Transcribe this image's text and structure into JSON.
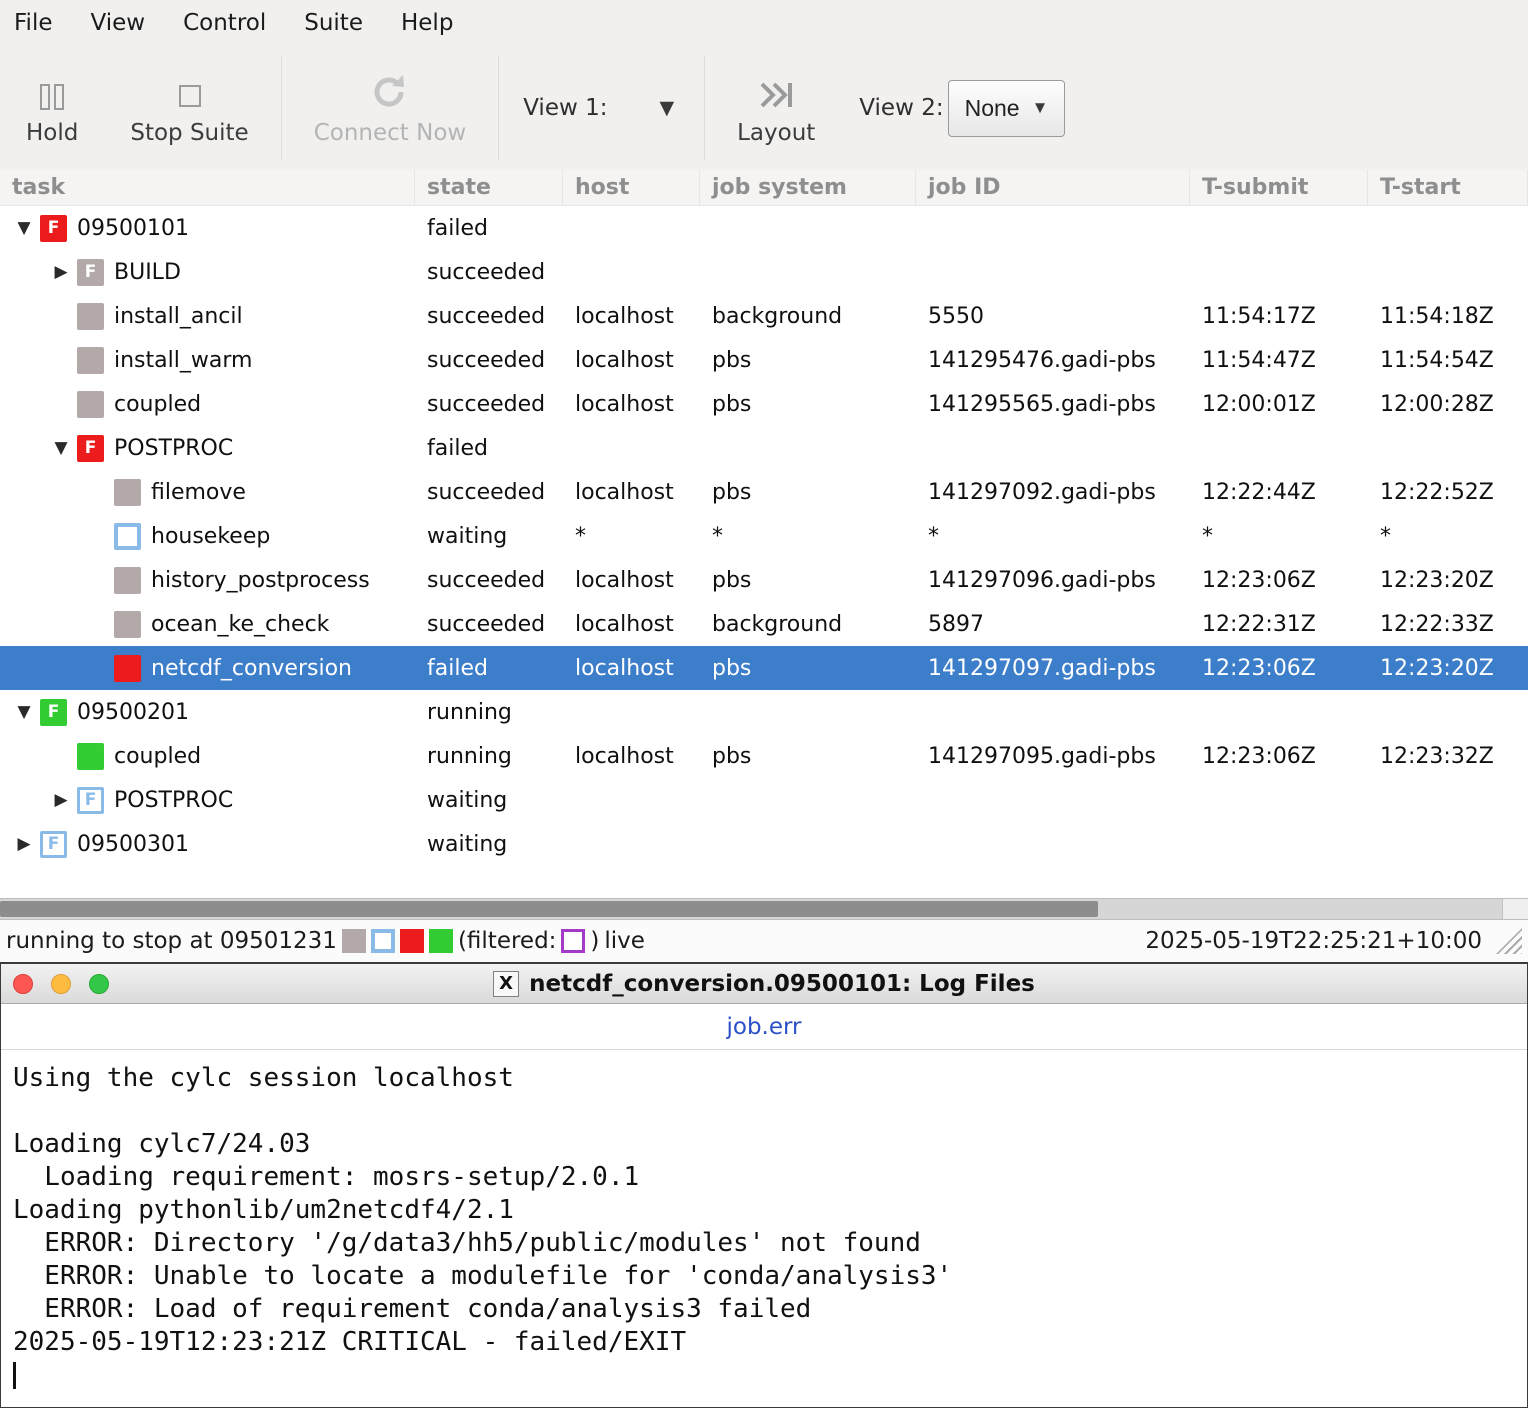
{
  "menu": {
    "items": [
      "File",
      "View",
      "Control",
      "Suite",
      "Help"
    ]
  },
  "toolbar": {
    "hold_label": "Hold",
    "stop_suite_label": "Stop Suite",
    "connect_now_label": "Connect Now",
    "view1_label": "View 1:",
    "layout_label": "Layout",
    "view2_label": "View 2:",
    "view2_value": "None"
  },
  "table": {
    "columns": [
      "task",
      "state",
      "host",
      "job system",
      "job ID",
      "T-submit",
      "T-start"
    ],
    "rows": [
      {
        "level": 0,
        "expander": "open",
        "icon": "family-failed",
        "task": "09500101",
        "state": "failed",
        "host": "",
        "job_system": "",
        "job_id": "",
        "t_submit": "",
        "t_start": "",
        "selected": false
      },
      {
        "level": 1,
        "expander": "closed",
        "icon": "family-succeeded",
        "task": "BUILD",
        "state": "succeeded",
        "host": "",
        "job_system": "",
        "job_id": "",
        "t_submit": "",
        "t_start": "",
        "selected": false
      },
      {
        "level": 1,
        "expander": null,
        "icon": "task-succeeded",
        "task": "install_ancil",
        "state": "succeeded",
        "host": "localhost",
        "job_system": "background",
        "job_id": "5550",
        "t_submit": "11:54:17Z",
        "t_start": "11:54:18Z",
        "selected": false
      },
      {
        "level": 1,
        "expander": null,
        "icon": "task-succeeded",
        "task": "install_warm",
        "state": "succeeded",
        "host": "localhost",
        "job_system": "pbs",
        "job_id": "141295476.gadi-pbs",
        "t_submit": "11:54:47Z",
        "t_start": "11:54:54Z",
        "selected": false
      },
      {
        "level": 1,
        "expander": null,
        "icon": "task-succeeded",
        "task": "coupled",
        "state": "succeeded",
        "host": "localhost",
        "job_system": "pbs",
        "job_id": "141295565.gadi-pbs",
        "t_submit": "12:00:01Z",
        "t_start": "12:00:28Z",
        "selected": false
      },
      {
        "level": 1,
        "expander": "open",
        "icon": "family-failed",
        "task": "POSTPROC",
        "state": "failed",
        "host": "",
        "job_system": "",
        "job_id": "",
        "t_submit": "",
        "t_start": "",
        "selected": false
      },
      {
        "level": 2,
        "expander": null,
        "icon": "task-succeeded",
        "task": "filemove",
        "state": "succeeded",
        "host": "localhost",
        "job_system": "pbs",
        "job_id": "141297092.gadi-pbs",
        "t_submit": "12:22:44Z",
        "t_start": "12:22:52Z",
        "selected": false
      },
      {
        "level": 2,
        "expander": null,
        "icon": "task-waiting",
        "task": "housekeep",
        "state": "waiting",
        "host": "*",
        "job_system": "*",
        "job_id": "*",
        "t_submit": "*",
        "t_start": "*",
        "selected": false
      },
      {
        "level": 2,
        "expander": null,
        "icon": "task-succeeded",
        "task": "history_postprocess",
        "state": "succeeded",
        "host": "localhost",
        "job_system": "pbs",
        "job_id": "141297096.gadi-pbs",
        "t_submit": "12:23:06Z",
        "t_start": "12:23:20Z",
        "selected": false
      },
      {
        "level": 2,
        "expander": null,
        "icon": "task-succeeded",
        "task": "ocean_ke_check",
        "state": "succeeded",
        "host": "localhost",
        "job_system": "background",
        "job_id": "5897",
        "t_submit": "12:22:31Z",
        "t_start": "12:22:33Z",
        "selected": false
      },
      {
        "level": 2,
        "expander": null,
        "icon": "task-failed",
        "task": "netcdf_conversion",
        "state": "failed",
        "host": "localhost",
        "job_system": "pbs",
        "job_id": "141297097.gadi-pbs",
        "t_submit": "12:23:06Z",
        "t_start": "12:23:20Z",
        "selected": true
      },
      {
        "level": 0,
        "expander": "open",
        "icon": "family-running",
        "task": "09500201",
        "state": "running",
        "host": "",
        "job_system": "",
        "job_id": "",
        "t_submit": "",
        "t_start": "",
        "selected": false
      },
      {
        "level": 1,
        "expander": null,
        "icon": "task-running",
        "task": "coupled",
        "state": "running",
        "host": "localhost",
        "job_system": "pbs",
        "job_id": "141297095.gadi-pbs",
        "t_submit": "12:23:06Z",
        "t_start": "12:23:32Z",
        "selected": false
      },
      {
        "level": 1,
        "expander": "closed",
        "icon": "family-waiting",
        "task": "POSTPROC",
        "state": "waiting",
        "host": "",
        "job_system": "",
        "job_id": "",
        "t_submit": "",
        "t_start": "",
        "selected": false
      },
      {
        "level": 0,
        "expander": "closed",
        "icon": "family-waiting",
        "task": "09500301",
        "state": "waiting",
        "host": "",
        "job_system": "",
        "job_id": "",
        "t_submit": "",
        "t_start": "",
        "selected": false
      }
    ]
  },
  "statusbar": {
    "left_text": "running to stop at 09501231",
    "filtered_open": "(filtered:",
    "filtered_close": ")",
    "live_label": "live",
    "timestamp": "2025-05-19T22:25:21+10:00"
  },
  "log_window": {
    "title": "netcdf_conversion.09500101: Log Files",
    "window_icon": "X",
    "tab": "job.err",
    "log_text": "Using the cylc session localhost\n\nLoading cylc7/24.03\n  Loading requirement: mosrs-setup/2.0.1\nLoading pythonlib/um2netcdf4/2.1\n  ERROR: Directory '/g/data3/hh5/public/modules' not found\n  ERROR: Unable to locate a modulefile for 'conda/analysis3'\n  ERROR: Load of requirement conda/analysis3 failed\n2025-05-19T12:23:21Z CRITICAL - failed/EXIT"
  },
  "colors": {
    "selection": "#3d7ecb",
    "failed": "#ed1c1c",
    "running": "#33cc33",
    "succeeded": "#b3a9a9",
    "waiting": "#8abbe8",
    "filtered": "#a43bc8",
    "tab_link": "#2b50c8"
  }
}
